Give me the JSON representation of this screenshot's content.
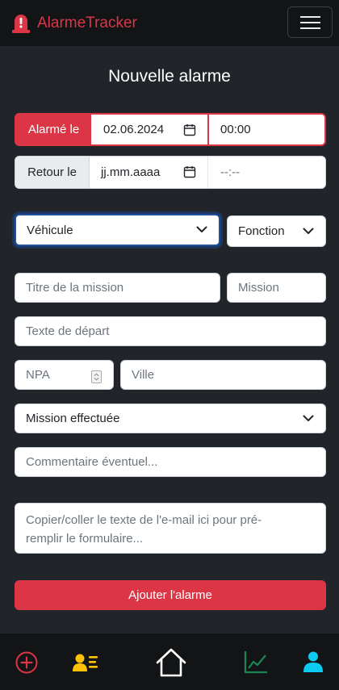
{
  "app": {
    "title": "AlarmeTracker"
  },
  "page": {
    "title": "Nouvelle alarme"
  },
  "form": {
    "alarm": {
      "label": "Alarmé le",
      "date": "02.06.2024",
      "time": "00:00"
    },
    "return": {
      "label": "Retour le",
      "date_placeholder": "jj.mm.aaaa",
      "time_placeholder": "--:--"
    },
    "vehicle": {
      "selected": "Véhicule"
    },
    "function": {
      "selected": "Fonction"
    },
    "mission_title": {
      "placeholder": "Titre de la mission"
    },
    "mission": {
      "placeholder": "Mission"
    },
    "departure_text": {
      "placeholder": "Texte de départ"
    },
    "npa": {
      "placeholder": "NPA"
    },
    "city": {
      "placeholder": "Ville"
    },
    "status": {
      "selected": "Mission effectuée"
    },
    "comment": {
      "placeholder": "Commentaire éventuel..."
    },
    "email_paste": {
      "placeholder_line1": "Copier/coller le texte de l'e-mail ici pour pré-",
      "placeholder_line2": "remplir le formulaire..."
    },
    "submit_label": "Ajouter l'alarme"
  },
  "bottom_nav": {
    "items": [
      {
        "icon": "add-circle-icon",
        "color": "#dc3545"
      },
      {
        "icon": "contacts-icon",
        "color": "#ffc107"
      },
      {
        "icon": "home-icon",
        "color": "#ffffff"
      },
      {
        "icon": "chart-line-icon",
        "color": "#198754"
      },
      {
        "icon": "user-icon",
        "color": "#0dcaf0"
      }
    ]
  },
  "colors": {
    "accent": "#dc3545",
    "background": "#212529",
    "navbar": "#121416"
  }
}
